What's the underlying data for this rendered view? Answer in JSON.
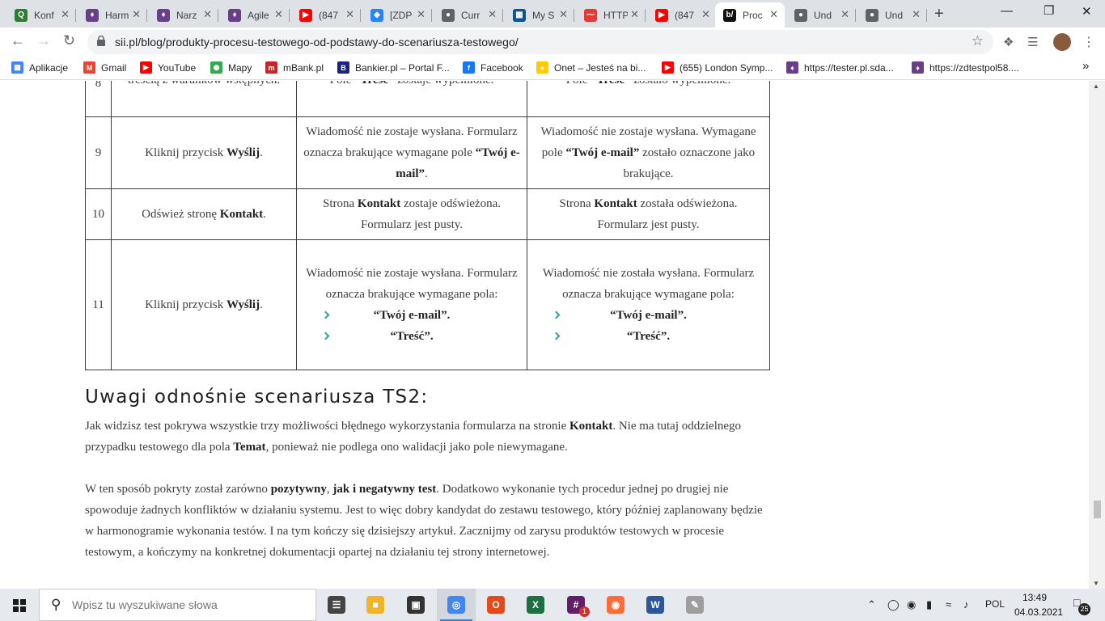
{
  "browser": {
    "tabs": [
      {
        "title": "Konf",
        "icon": "q-icon",
        "color": "#2e7d32"
      },
      {
        "title": "Harm",
        "icon": "harmony-icon",
        "color": "#6a3f8a"
      },
      {
        "title": "Narz",
        "icon": "harmony-icon",
        "color": "#6a3f8a"
      },
      {
        "title": "Agile",
        "icon": "harmony-icon",
        "color": "#6a3f8a"
      },
      {
        "title": "(847",
        "icon": "youtube-icon",
        "color": "#ff0000"
      },
      {
        "title": "[ZDP",
        "icon": "jira-icon",
        "color": "#2684ff"
      },
      {
        "title": "Curr",
        "icon": "globe-icon",
        "color": "#5f6368"
      },
      {
        "title": "My S",
        "icon": "grid-icon",
        "color": "#0b5394"
      },
      {
        "title": "HTTP",
        "icon": "mustache-icon",
        "color": "#e53935"
      },
      {
        "title": "(847",
        "icon": "youtube-icon",
        "color": "#ff0000"
      },
      {
        "title": "Proc",
        "icon": "blog-icon",
        "color": "#111111",
        "active": true
      },
      {
        "title": "Und",
        "icon": "globe-icon",
        "color": "#5f6368"
      },
      {
        "title": "Und",
        "icon": "globe-icon",
        "color": "#5f6368"
      }
    ],
    "url": "sii.pl/blog/produkty-procesu-testowego-od-podstawy-do-scenariusza-testowego/",
    "bookmarks": [
      {
        "label": "Aplikacje",
        "color": "#4285f4"
      },
      {
        "label": "Gmail",
        "color": "#ea4335"
      },
      {
        "label": "YouTube",
        "color": "#ff0000"
      },
      {
        "label": "Mapy",
        "color": "#34a853"
      },
      {
        "label": "mBank.pl",
        "color": "#c62828"
      },
      {
        "label": "Bankier.pl – Portal F...",
        "color": "#1a237e"
      },
      {
        "label": "Facebook",
        "color": "#1877f2"
      },
      {
        "label": "Onet – Jesteś na bi...",
        "color": "#ffcc00"
      },
      {
        "label": "(655) London Symp...",
        "color": "#ff0000"
      },
      {
        "label": "https://tester.pl.sda...",
        "color": "#6a3f8a"
      },
      {
        "label": "https://zdtestpol58....",
        "color": "#6a3f8a"
      }
    ],
    "overflow": "»"
  },
  "table": {
    "rows": [
      {
        "num": "8",
        "step": "treścią z warunków wstępnych.",
        "expected_html": "Pole <b>“Treść”</b> zostaje wypełnione.",
        "actual_html": "Pole <b>“Treść”</b> zostało wypełnione."
      },
      {
        "num": "9",
        "step_html": "Kliknij przycisk <b>Wyślij</b>.",
        "expected_html": "Wiadomość nie zostaje wysłana. Formularz oznacza brakujące wymagane pole <b>“Twój e-mail”</b>.",
        "actual_html": "Wiadomość nie zostaje wysłana. Wymagane pole <b>“Twój e-mail”</b> zostało oznaczone jako brakujące."
      },
      {
        "num": "10",
        "step_html": "Odśwież stronę <b>Kontakt</b>.",
        "expected_html": "Strona <b>Kontakt</b> zostaje odświeżona. Formularz jest pusty.",
        "actual_html": "Strona <b>Kontakt</b> została odświeżona. Formularz jest pusty."
      },
      {
        "num": "11",
        "step_html": "Kliknij przycisk <b>Wyślij</b>.",
        "expected_intro": "Wiadomość nie zostaje wysłana. Formularz oznacza brakujące wymagane pola:",
        "expected_items": [
          "“Twój e-mail”.",
          "“Treść”."
        ],
        "actual_intro": "Wiadomość nie została wysłana. Formularz oznacza brakujące wymagane pola:",
        "actual_items": [
          "“Twój e-mail”.",
          "“Treść”."
        ]
      }
    ]
  },
  "article": {
    "heading": "Uwagi odnośnie scenariusza TS2:",
    "p1_html": "Jak widzisz test pokrywa wszystkie trzy możliwości błędnego wykorzystania formularza na stronie <b>Kontakt</b>. Nie ma tutaj oddzielnego przypadku testowego dla pola <b>Temat</b>, ponieważ nie podlega ono walidacji jako pole niewymagane.",
    "p2_html": "W ten sposób pokryty został zarówno <b>pozytywny</b>, <b>jak i negatywny test</b>. Dodatkowo wykonanie tych procedur jednej po drugiej nie spowoduje żadnych konfliktów w działaniu systemu. Jest to więc dobry kandydat do zestawu testowego, który później zaplanowany będzie w harmonogramie wykonania testów. I na tym kończy się dzisiejszy artykuł. Zacznijmy od zarysu produktów testowych w procesie testowym, a kończymy na konkretnej dokumentacji opartej na działaniu tej strony internetowej."
  },
  "taskbar": {
    "search_placeholder": "Wpisz tu wyszukiwane słowa",
    "apps": [
      {
        "name": "task-view",
        "color": "#444"
      },
      {
        "name": "file-explorer",
        "color": "#f0b429"
      },
      {
        "name": "store",
        "color": "#333"
      },
      {
        "name": "chrome",
        "color": "#4285f4",
        "active": true
      },
      {
        "name": "office",
        "color": "#e64a19"
      },
      {
        "name": "excel",
        "color": "#1d6f42"
      },
      {
        "name": "slack",
        "color": "#611f69"
      },
      {
        "name": "postman",
        "color": "#ff6c37"
      },
      {
        "name": "word",
        "color": "#2b579a"
      },
      {
        "name": "paint",
        "color": "#9e9e9e"
      }
    ],
    "slack_badge": "1",
    "language": "POL",
    "time": "13:49",
    "date": "04.03.2021",
    "notifications": "25"
  }
}
